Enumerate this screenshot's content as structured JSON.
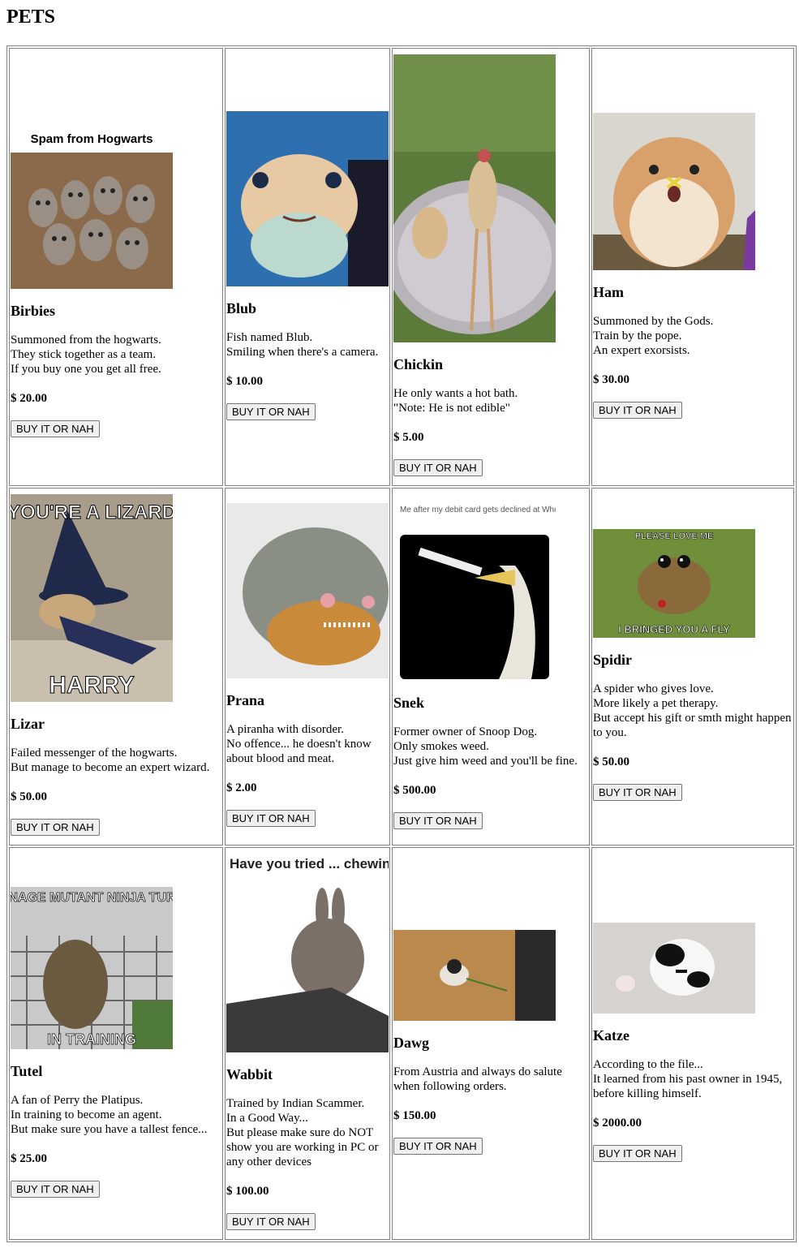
{
  "page": {
    "title": "PETS"
  },
  "button_label": "BUY IT OR NAH",
  "pets": [
    {
      "name": "Birbies",
      "desc": "Summoned from the hogwarts.\nThey stick together as a team.\nIf you buy one you get all free.",
      "price": "$ 20.00",
      "image_caption": "Spam from Hogwarts",
      "image": "owls-photo"
    },
    {
      "name": "Blub",
      "desc": "Fish named Blub.\nSmiling when there's a camera.",
      "price": "$ 10.00",
      "image": "pufferfish-photo"
    },
    {
      "name": "Chickin",
      "desc": "He only wants a hot bath.\n\"Note: He is not edible\"",
      "price": "$ 5.00",
      "image": "chicken-photo"
    },
    {
      "name": "Ham",
      "desc": "Summoned by the Gods.\nTrain by the pope.\nAn expert exorsists.",
      "price": "$ 30.00",
      "image": "hamster-photo"
    },
    {
      "name": "Lizar",
      "desc": "Failed messenger of the hogwarts.\nBut manage to become an expert wizard.",
      "price": "$ 50.00",
      "image_top_text": "YOU'RE A LIZARD",
      "image_bottom_text": "HARRY",
      "image": "lizard-photo"
    },
    {
      "name": "Prana",
      "desc": "A piranha with disorder.\nNo offence... he doesn't know about blood and meat.",
      "price": "$ 2.00",
      "image": "piranha-photo"
    },
    {
      "name": "Snek",
      "desc": "Former owner of Snoop Dog.\nOnly smokes weed.\nJust give him weed and you'll be fine.",
      "price": "$ 500.00",
      "image_caption": "Me after my debit card gets declined at Whole Foods",
      "image": "snake-photo"
    },
    {
      "name": "Spidir",
      "desc": "A spider who gives love.\nMore likely a pet therapy.\nBut accept his gift or smth might happen to you.",
      "price": "$ 50.00",
      "image_top_text": "PLEASE LOVE ME",
      "image_bottom_text": "I BRINGED YOU A FLY",
      "image": "spider-photo"
    },
    {
      "name": "Tutel",
      "desc": "A fan of Perry the Platipus.\nIn training to become an agent.\nBut make sure you have a tallest fence...",
      "price": "$ 25.00",
      "image_top_text": "TEENAGE MUTANT NINJA TURTLE",
      "image_bottom_text": "IN TRAINING",
      "image": "turtle-photo"
    },
    {
      "name": "Wabbit",
      "desc": "Trained by Indian Scammer.\nIn a Good Way...\nBut please make sure do NOT show you are working in PC or any other devices",
      "price": "$ 100.00",
      "image_caption": "Have you tried ... chewing on the cable?",
      "image": "rabbit-photo"
    },
    {
      "name": "Dawg",
      "desc": "From Austria and always do salute when following orders.",
      "price": "$ 150.00",
      "image": "dog-photo"
    },
    {
      "name": "Katze",
      "desc": "According to the file...\nIt learned from his past owner in 1945, before killing himself.",
      "price": "$ 2000.00",
      "image": "cat-photo"
    }
  ]
}
